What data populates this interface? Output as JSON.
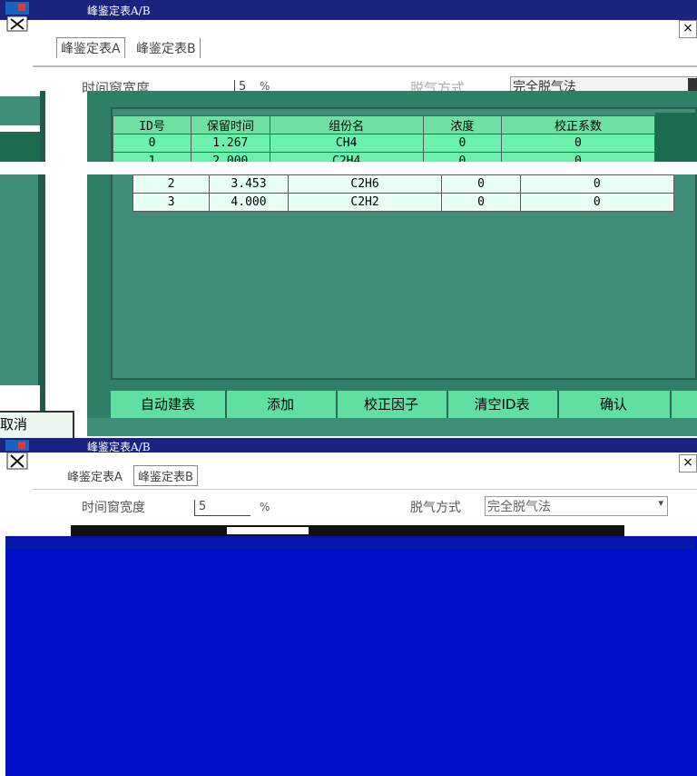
{
  "window": {
    "title": "峰鉴定表A/B",
    "close_glyph": "×"
  },
  "tabs": [
    {
      "label": "峰鉴定表A"
    },
    {
      "label": "峰鉴定表B"
    }
  ],
  "form": {
    "time_window_label": "时间窗宽度",
    "time_window_value": "5",
    "time_window_unit": "%",
    "degas_label": "脱气方式",
    "degas_value": "完全脱气法",
    "dropdown_icon": "chevron-down"
  },
  "table": {
    "headers": [
      "ID号",
      "保留时间",
      "组份名",
      "浓度",
      "校正系数"
    ],
    "rows": [
      {
        "id": "0",
        "time": "1.267",
        "name": "CH4",
        "conc": "0",
        "coef": "0"
      },
      {
        "id": "1",
        "time": "2.000",
        "name": "C2H4",
        "conc": "0",
        "coef": "0"
      },
      {
        "id": "2",
        "time": "3.453",
        "name": "C2H6",
        "conc": "0",
        "coef": "0"
      },
      {
        "id": "3",
        "time": "4.000",
        "name": "C2H2",
        "conc": "0",
        "coef": "0"
      }
    ]
  },
  "buttons": {
    "auto_build": "自动建表",
    "add": "添加",
    "calibrate": "校正因子",
    "clear": "清空ID表",
    "confirm": "确认",
    "cancel": "取消"
  },
  "colors": {
    "titlebar": "#1a237e",
    "teal": "#3f8e7a",
    "header_green": "#6ee0a4",
    "overlay_blue": "#0010c8"
  }
}
